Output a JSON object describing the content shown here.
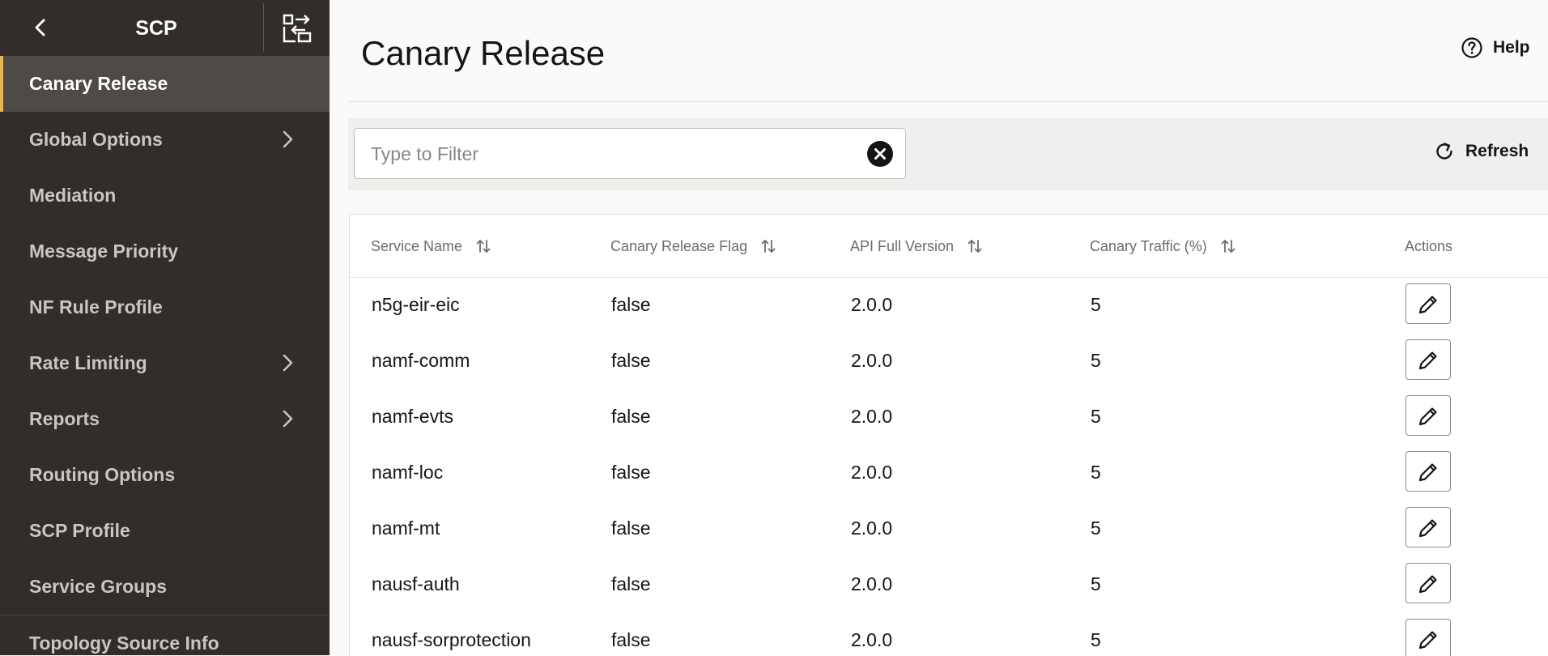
{
  "sidebar": {
    "title": "SCP",
    "items": [
      {
        "label": "Canary Release",
        "active": true,
        "has_children": false
      },
      {
        "label": "Global Options",
        "active": false,
        "has_children": true
      },
      {
        "label": "Mediation",
        "active": false,
        "has_children": false
      },
      {
        "label": "Message Priority",
        "active": false,
        "has_children": false
      },
      {
        "label": "NF Rule Profile",
        "active": false,
        "has_children": false
      },
      {
        "label": "Rate Limiting",
        "active": false,
        "has_children": true
      },
      {
        "label": "Reports",
        "active": false,
        "has_children": true
      },
      {
        "label": "Routing Options",
        "active": false,
        "has_children": false
      },
      {
        "label": "SCP Profile",
        "active": false,
        "has_children": false
      },
      {
        "label": "Service Groups",
        "active": false,
        "has_children": false
      },
      {
        "label": "Topology Source Info",
        "active": false,
        "has_children": false
      }
    ]
  },
  "header": {
    "title": "Canary Release",
    "help_label": "Help"
  },
  "toolbar": {
    "filter_placeholder": "Type to Filter",
    "filter_value": "",
    "refresh_label": "Refresh"
  },
  "table": {
    "columns": [
      {
        "label": "Service Name",
        "sortable": true
      },
      {
        "label": "Canary Release Flag",
        "sortable": true
      },
      {
        "label": "API Full Version",
        "sortable": true
      },
      {
        "label": "Canary Traffic (%)",
        "sortable": true
      },
      {
        "label": "Actions",
        "sortable": false
      }
    ],
    "rows": [
      {
        "service": "n5g-eir-eic",
        "flag": "false",
        "version": "2.0.0",
        "traffic": "5"
      },
      {
        "service": "namf-comm",
        "flag": "false",
        "version": "2.0.0",
        "traffic": "5"
      },
      {
        "service": "namf-evts",
        "flag": "false",
        "version": "2.0.0",
        "traffic": "5"
      },
      {
        "service": "namf-loc",
        "flag": "false",
        "version": "2.0.0",
        "traffic": "5"
      },
      {
        "service": "namf-mt",
        "flag": "false",
        "version": "2.0.0",
        "traffic": "5"
      },
      {
        "service": "nausf-auth",
        "flag": "false",
        "version": "2.0.0",
        "traffic": "5"
      },
      {
        "service": "nausf-sorprotection",
        "flag": "false",
        "version": "2.0.0",
        "traffic": "5"
      }
    ]
  },
  "colors": {
    "sidebar_bg": "#312d2a",
    "sidebar_active_bg": "#4f4a45",
    "accent": "#e3b85b",
    "text": "#161513"
  },
  "icons": {
    "back": "chevron-left-icon",
    "toggle": "collapse-panel-icon",
    "help": "help-circle-icon",
    "clear": "close-circle-icon",
    "refresh": "refresh-icon",
    "sort": "sort-arrows-icon",
    "edit": "pencil-icon",
    "chevron": "chevron-right-icon"
  }
}
